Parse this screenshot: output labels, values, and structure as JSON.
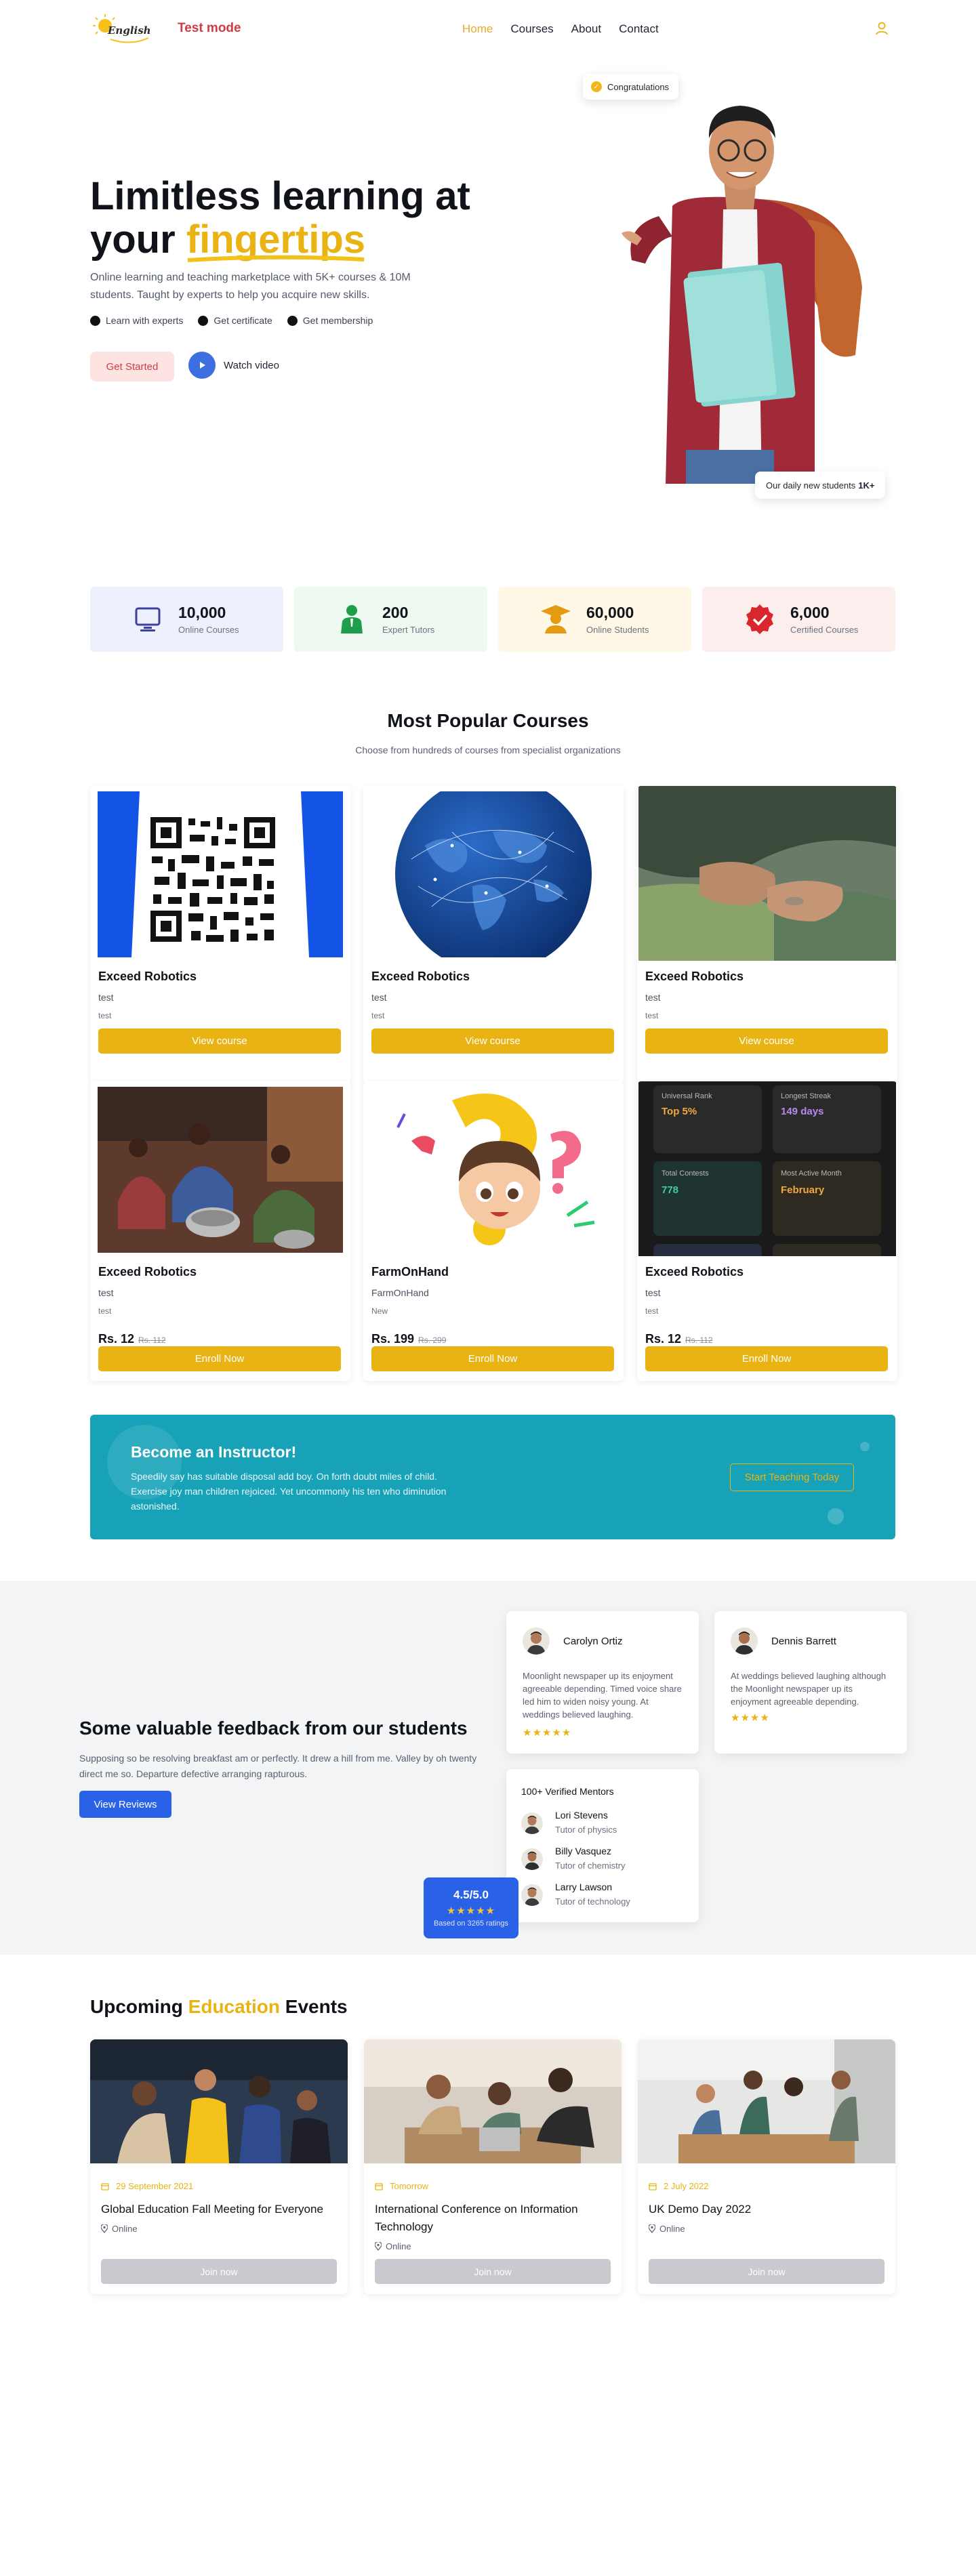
{
  "header": {
    "test_mode": "Test mode",
    "logo_text": "English",
    "nav": [
      "Home",
      "Courses",
      "About",
      "Contact"
    ],
    "accent": "#e9b313"
  },
  "hero": {
    "title_line1": "Limitless learning at",
    "title_line2_prefix": "your ",
    "title_highlight": "fingertips",
    "description": "Online learning and teaching marketplace with 5K+ courses & 10M students. Taught by experts to help you acquire new skills.",
    "points": [
      "Learn with experts",
      "Get certificate",
      "Get membership"
    ],
    "cta_start": "Get Started",
    "cta_watch": "Watch video",
    "congrats": "Congratulations",
    "daily_label": "Our daily new students",
    "daily_value": "1K+"
  },
  "stats": [
    {
      "value": "10,000",
      "label": "Online Courses",
      "icon": "monitor-icon",
      "bg": "#eef0fd",
      "color": "#3b3f9f"
    },
    {
      "value": "200",
      "label": "Expert Tutors",
      "icon": "tutor-icon",
      "bg": "#eefaf1",
      "color": "#1e9e4a"
    },
    {
      "value": "60,000",
      "label": "Online Students",
      "icon": "graduate-icon",
      "bg": "#fff8e7",
      "color": "#e49b12"
    },
    {
      "value": "6,000",
      "label": "Certified Courses",
      "icon": "certified-badge-icon",
      "bg": "#fdeeee",
      "color": "#d9272e"
    }
  ],
  "popular": {
    "title": "Most Popular Courses",
    "subtitle": "Choose from hundreds of courses from specialist organizations",
    "cards": [
      {
        "name": "Exceed Robotics",
        "line1": "test",
        "line2": "test",
        "button": "View course"
      },
      {
        "name": "Exceed Robotics",
        "line1": "test",
        "line2": "test",
        "button": "View course"
      },
      {
        "name": "Exceed Robotics",
        "line1": "test",
        "line2": "test",
        "button": "View course"
      },
      {
        "name": "Exceed Robotics",
        "line1": "test",
        "line2": "test",
        "price": "Rs. 12",
        "old_price": "Rs. 112",
        "button": "Enroll Now"
      },
      {
        "name": "FarmOnHand",
        "line1": "FarmOnHand",
        "line2": "New",
        "price": "Rs. 199",
        "old_price": "Rs. 299",
        "button": "Enroll Now"
      },
      {
        "name": "Exceed Robotics",
        "line1": "test",
        "line2": "test",
        "price": "Rs. 12",
        "old_price": "Rs. 112",
        "button": "Enroll Now"
      }
    ],
    "stats_tiles": {
      "rank_label": "Universal Rank",
      "rank_value": "Top 5%",
      "streak_label": "Longest Streak",
      "streak_value": "149 days",
      "contests_label": "Total Contests",
      "contests_value": "778",
      "month_label": "Most Active Month",
      "month_value": "February"
    }
  },
  "instructor": {
    "title": "Become an Instructor!",
    "text": "Speedily say has suitable disposal add boy. On forth doubt miles of child. Exercise joy man children rejoiced. Yet uncommonly his ten who diminution astonished.",
    "button": "Start Teaching Today"
  },
  "feedback": {
    "title": "Some valuable feedback from our students",
    "text": "Supposing so be resolving breakfast am or perfectly. It drew a hill from me. Valley by oh twenty direct me so. Departure defective arranging rapturous.",
    "button": "View Reviews",
    "reviews": [
      {
        "name": "Carolyn Ortiz",
        "text": "Moonlight newspaper up its enjoyment agreeable depending. Timed voice share led him to widen noisy young. At weddings believed laughing.",
        "stars": "★★★★★"
      },
      {
        "name": "Dennis Barrett",
        "text": "At weddings believed laughing although the Moonlight newspaper up its enjoyment agreeable depending.",
        "stars": "★★★★"
      }
    ],
    "mentors_title": "100+ Verified Mentors",
    "mentors": [
      {
        "name": "Lori Stevens",
        "role": "Tutor of physics"
      },
      {
        "name": "Billy Vasquez",
        "role": "Tutor of chemistry"
      },
      {
        "name": "Larry Lawson",
        "role": "Tutor of technology"
      }
    ],
    "rating_value": "4.5/5.0",
    "rating_stars": "★★★★★",
    "rating_based": "Based on 3265 ratings"
  },
  "events": {
    "title_prefix": "Upcoming ",
    "title_highlight": "Education",
    "title_suffix": " Events",
    "items": [
      {
        "date": "29 September 2021",
        "title": "Global Education Fall Meeting for Everyone",
        "location": "Online",
        "button": "Join now"
      },
      {
        "date": "Tomorrow",
        "title": "International Conference on Information Technology",
        "location": "Online",
        "button": "Join now"
      },
      {
        "date": "2 July 2022",
        "title": "UK Demo Day 2022",
        "location": "Online",
        "button": "Join now"
      }
    ]
  }
}
